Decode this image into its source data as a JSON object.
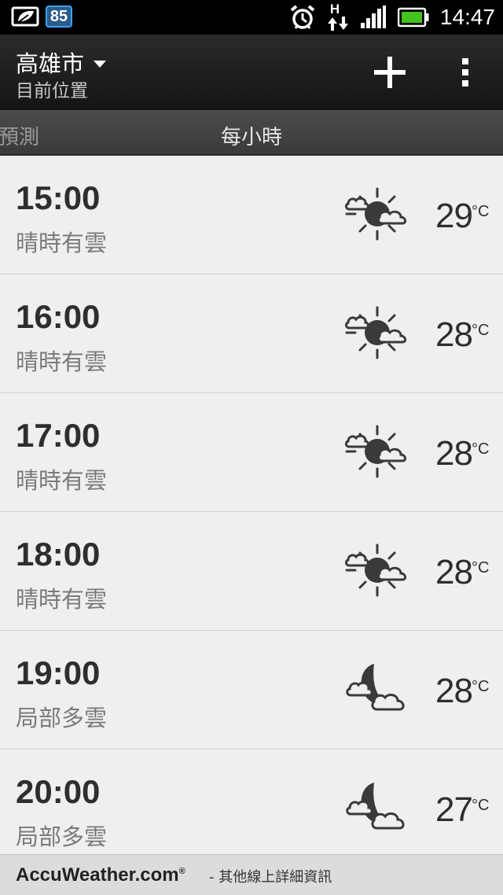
{
  "status_bar": {
    "badge": "85",
    "time": "14:47",
    "network_label": "H",
    "icons": [
      "leaf-notification-icon",
      "alarm-icon",
      "data-arrows-icon",
      "signal-icon",
      "battery-icon"
    ]
  },
  "action_bar": {
    "city": "高雄市",
    "subtitle": "目前位置",
    "icons": [
      "add-icon",
      "overflow-menu-icon"
    ]
  },
  "tabs": {
    "previous": "預測",
    "current": "每小時"
  },
  "forecast": [
    {
      "time": "15:00",
      "desc": "晴時有雲",
      "temp": "29",
      "unit": "°C",
      "icon": "partly-sunny-icon"
    },
    {
      "time": "16:00",
      "desc": "晴時有雲",
      "temp": "28",
      "unit": "°C",
      "icon": "partly-sunny-icon"
    },
    {
      "time": "17:00",
      "desc": "晴時有雲",
      "temp": "28",
      "unit": "°C",
      "icon": "partly-sunny-icon"
    },
    {
      "time": "18:00",
      "desc": "晴時有雲",
      "temp": "28",
      "unit": "°C",
      "icon": "partly-sunny-icon"
    },
    {
      "time": "19:00",
      "desc": "局部多雲",
      "temp": "28",
      "unit": "°C",
      "icon": "partly-cloudy-night-icon"
    },
    {
      "time": "20:00",
      "desc": "局部多雲",
      "temp": "27",
      "unit": "°C",
      "icon": "partly-cloudy-night-icon"
    }
  ],
  "footer": {
    "brand": "AccuWeather.com",
    "registered": "®",
    "link_text": "- 其他線上詳細資訊"
  },
  "colors": {
    "status_bar_bg": "#000000",
    "action_bar_bg": "#1e1e1e",
    "tab_bg": "#444444",
    "list_bg": "#efefef",
    "text_dark": "#2e2e2e",
    "text_muted": "#7a7a7a",
    "badge_blue": "#3ea3ff",
    "battery_green": "#44c21d"
  }
}
